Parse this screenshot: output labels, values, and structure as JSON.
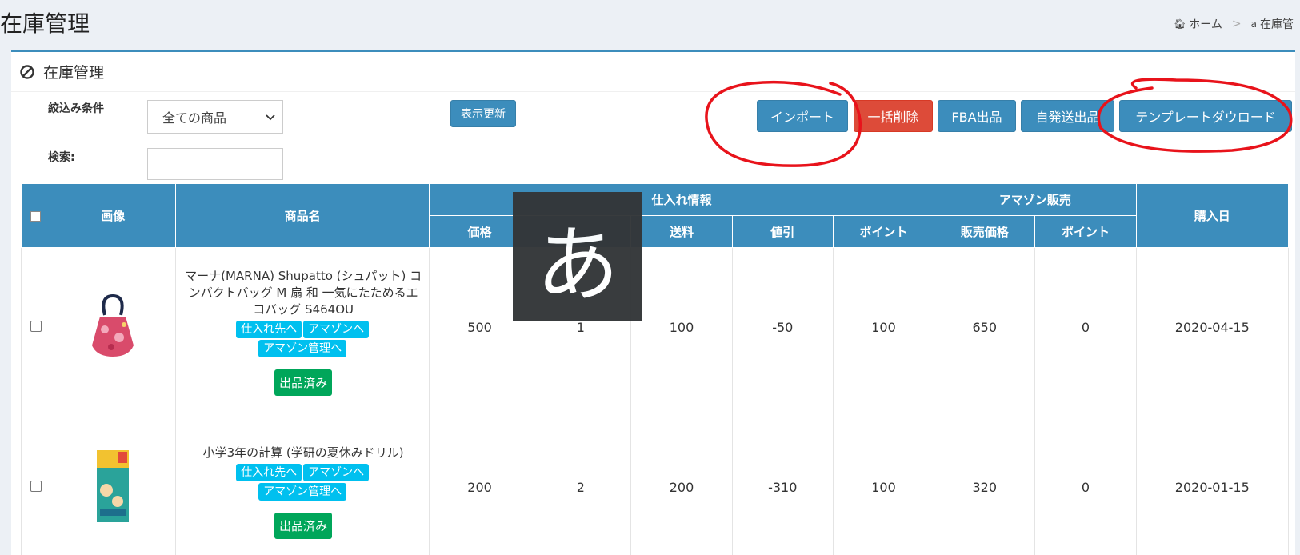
{
  "header": {
    "title": "在庫管理",
    "breadcrumb": [
      "ホーム",
      "在庫管"
    ],
    "breadcrumb_separator": ">"
  },
  "box": {
    "title": "在庫管理"
  },
  "filter": {
    "label": "絞込み条件",
    "select_value": "全ての商品",
    "search_label": "検索:",
    "search_value": "",
    "refresh_label": "表示更新"
  },
  "actions": {
    "import": "インポート",
    "bulk_delete": "一括削除",
    "fba": "FBA出品",
    "self_ship": "自発送出品",
    "template_download": "テンプレートダウロード"
  },
  "table": {
    "headers": {
      "image": "画像",
      "product_name": "商品名",
      "purchase_info": "仕入れ情報",
      "amazon_sales": "アマゾン販売",
      "purchase_date": "購入日",
      "price": "価格",
      "shipping": "送料",
      "discount": "値引",
      "points": "ポイント",
      "sale_price": "販売価格",
      "amazon_points": "ポイント"
    },
    "rows": [
      {
        "name": "マーナ(MARNA) Shupatto (シュパット) コンパクトバッグ M 扇 和 一気にたためるエコバッグ S464OU",
        "tags": [
          "仕入れ先へ",
          "アマゾンへ",
          "アマゾン管理へ"
        ],
        "status": "出品済み",
        "price": "500",
        "qty": "1",
        "shipping": "100",
        "discount": "-50",
        "points": "100",
        "sale_price": "650",
        "amazon_points": "0",
        "date": "2020-04-15"
      },
      {
        "name": "小学3年の計算 (学研の夏休みドリル)",
        "tags": [
          "仕入れ先へ",
          "アマゾンへ",
          "アマゾン管理へ"
        ],
        "status": "出品済み",
        "price": "200",
        "qty": "2",
        "shipping": "200",
        "discount": "-310",
        "points": "100",
        "sale_price": "320",
        "amazon_points": "0",
        "date": "2020-01-15"
      }
    ]
  },
  "ime_indicator": "あ",
  "colors": {
    "primary": "#3c8dbc",
    "danger": "#dd4b39",
    "info": "#00c0ef",
    "success": "#00a65a",
    "annotation": "#e8131b"
  },
  "icons": {
    "title": "ban-icon",
    "breadcrumb_home": "home-icon",
    "breadcrumb_amazon": "amazon-icon"
  }
}
